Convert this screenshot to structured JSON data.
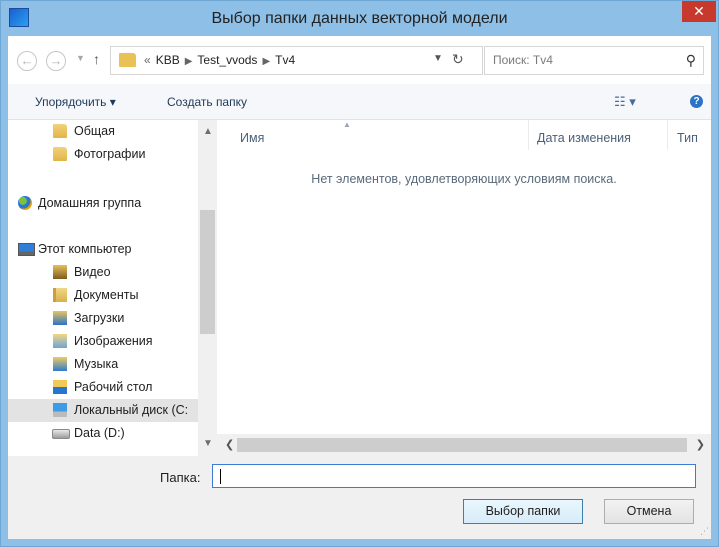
{
  "window": {
    "title": "Выбор папки данных векторной модели",
    "close_glyph": "✕"
  },
  "navbar": {
    "back_glyph": "←",
    "forward_glyph": "→",
    "up_glyph": "↑",
    "breadcrumb_prefix": "«",
    "breadcrumbs": [
      "KBB",
      "Test_vvods",
      "Tv4"
    ],
    "search_placeholder": "Поиск: Tv4"
  },
  "toolbar": {
    "organize_label": "Упорядочить ▾",
    "new_folder_label": "Создать папку",
    "view_glyph": "☷ ▾",
    "help_glyph": "?"
  },
  "navpane": {
    "items": [
      {
        "label": "Общая",
        "icon": "folder-icon"
      },
      {
        "label": "Фотографии",
        "icon": "folder-icon"
      },
      {
        "label": "Домашняя группа",
        "icon": "homegroup-icon"
      },
      {
        "label": "Этот компьютер",
        "icon": "computer-icon"
      },
      {
        "label": "Видео",
        "icon": "video-folder-icon"
      },
      {
        "label": "Документы",
        "icon": "documents-folder-icon"
      },
      {
        "label": "Загрузки",
        "icon": "downloads-folder-icon"
      },
      {
        "label": "Изображения",
        "icon": "images-folder-icon"
      },
      {
        "label": "Музыка",
        "icon": "music-folder-icon"
      },
      {
        "label": "Рабочий стол",
        "icon": "desktop-folder-icon"
      },
      {
        "label": "Локальный диск (C:",
        "icon": "local-disk-icon"
      },
      {
        "label": "Data (D:)",
        "icon": "disk-drive-icon"
      }
    ],
    "selected_index": 10
  },
  "content": {
    "columns": [
      "Имя",
      "Дата изменения",
      "Тип"
    ],
    "empty_message": "Нет элементов, удовлетворяющих условиям поиска."
  },
  "bottom": {
    "folder_label": "Папка:",
    "folder_value": "",
    "select_button": "Выбор папки",
    "cancel_button": "Отмена"
  },
  "colors": {
    "titlebar": "#8ebfe7",
    "close_button": "#c7392d",
    "selected_item": "#e3e3e3"
  }
}
